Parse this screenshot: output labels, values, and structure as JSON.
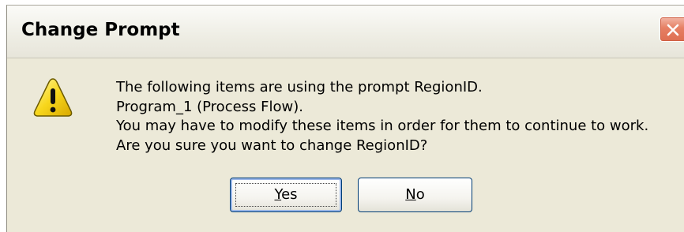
{
  "dialog": {
    "title": "Change Prompt",
    "icon": "warning-icon",
    "message_lines": [
      "The following items are using the prompt RegionID.",
      "Program_1 (Process Flow).",
      "You may have to modify these items in order for them to continue to work.",
      "Are you sure you want to change RegionID?"
    ],
    "buttons": {
      "yes": {
        "mnemonic": "Y",
        "rest": "es"
      },
      "no": {
        "mnemonic": "N",
        "rest": "o"
      }
    }
  },
  "colors": {
    "dialog_background": "#ece9d8",
    "close_button": "#e0735a",
    "button_border": "#003c74",
    "warning_yellow": "#f5d31b"
  }
}
